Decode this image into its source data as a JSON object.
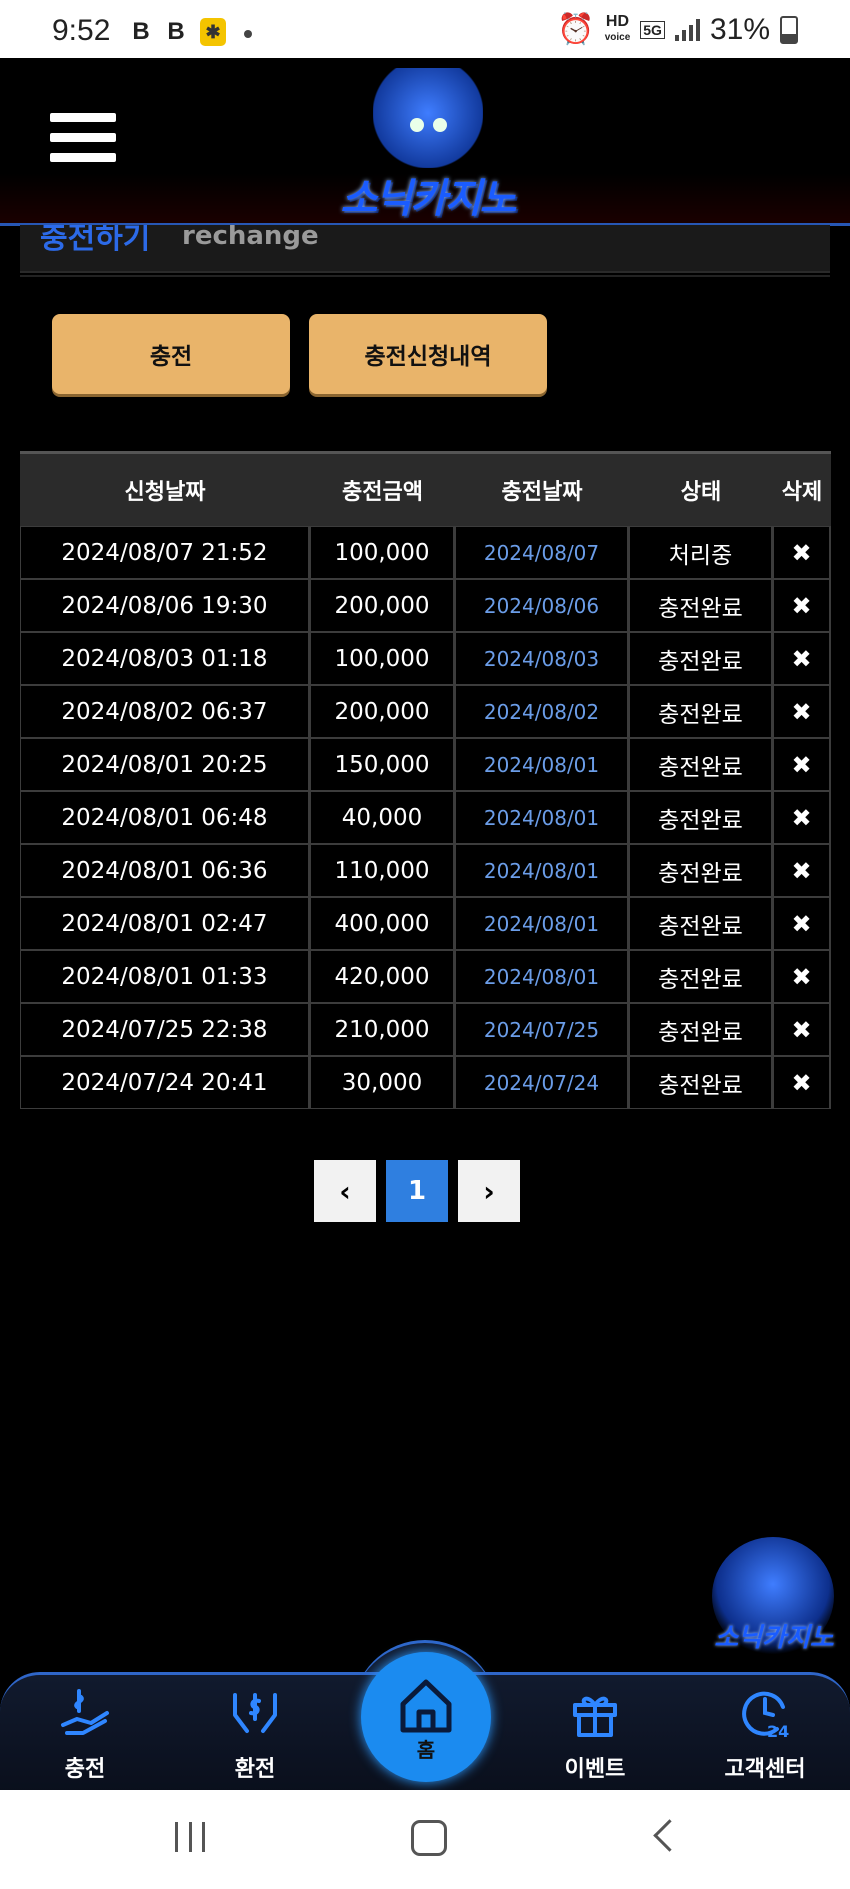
{
  "status_bar": {
    "time": "9:52",
    "app_icons": [
      "B",
      "B"
    ],
    "hd": "HD",
    "hd_sub": "voice",
    "network": "5G",
    "battery": "31%"
  },
  "header": {
    "logo_text": "소닉카지노"
  },
  "page_title": {
    "korean": "충전하기",
    "english": "rechange"
  },
  "buttons": {
    "charge": "충전",
    "history": "충전신청내역"
  },
  "table": {
    "headers": [
      "신청날짜",
      "충전금액",
      "충전날짜",
      "상태",
      "삭제"
    ],
    "rows": [
      {
        "req": "2024/08/07 21:52",
        "amount": "100,000",
        "date": "2024/08/07",
        "status": "처리중"
      },
      {
        "req": "2024/08/06 19:30",
        "amount": "200,000",
        "date": "2024/08/06",
        "status": "충전완료"
      },
      {
        "req": "2024/08/03 01:18",
        "amount": "100,000",
        "date": "2024/08/03",
        "status": "충전완료"
      },
      {
        "req": "2024/08/02 06:37",
        "amount": "200,000",
        "date": "2024/08/02",
        "status": "충전완료"
      },
      {
        "req": "2024/08/01 20:25",
        "amount": "150,000",
        "date": "2024/08/01",
        "status": "충전완료"
      },
      {
        "req": "2024/08/01 06:48",
        "amount": "40,000",
        "date": "2024/08/01",
        "status": "충전완료"
      },
      {
        "req": "2024/08/01 06:36",
        "amount": "110,000",
        "date": "2024/08/01",
        "status": "충전완료"
      },
      {
        "req": "2024/08/01 02:47",
        "amount": "400,000",
        "date": "2024/08/01",
        "status": "충전완료"
      },
      {
        "req": "2024/08/01 01:33",
        "amount": "420,000",
        "date": "2024/08/01",
        "status": "충전완료"
      },
      {
        "req": "2024/07/25 22:38",
        "amount": "210,000",
        "date": "2024/07/25",
        "status": "충전완료"
      },
      {
        "req": "2024/07/24 20:41",
        "amount": "30,000",
        "date": "2024/07/24",
        "status": "충전완료"
      }
    ],
    "delete_glyph": "✖"
  },
  "pagination": {
    "prev": "‹",
    "current": "1",
    "next": "›"
  },
  "floating_badge": {
    "text": "소닉카지노"
  },
  "bottom_nav": {
    "charge": "충전",
    "exchange": "환전",
    "home": "홈",
    "event": "이벤트",
    "support": "고객센터"
  },
  "colors": {
    "accent_gold": "#e9b46a",
    "nav_blue": "#1b8bf0",
    "link_blue": "#6b9de8"
  },
  "icons": [
    "hamburger-menu-icon",
    "delete-x-icon",
    "chevron-left-icon",
    "chevron-right-icon",
    "charge-hand-dollar-icon",
    "exchange-hands-dollar-icon",
    "home-icon",
    "gift-icon",
    "support-24-icon"
  ]
}
